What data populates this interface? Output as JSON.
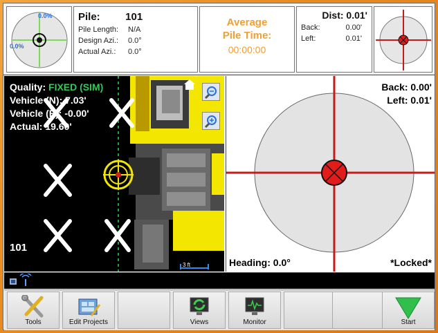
{
  "top": {
    "target_pct_top": "0.0%",
    "target_pct_left": "0.0%",
    "pile_label": "Pile:",
    "pile_number": "101",
    "pile_length_label": "Pile Length:",
    "pile_length_value": "N/A",
    "design_azi_label": "Design Azi.:",
    "design_azi_value": "0.0°",
    "actual_azi_label": "Actual Azi.:",
    "actual_azi_value": "0.0°",
    "avg_title_1": "Average",
    "avg_title_2": "Pile Time:",
    "avg_time": "00:00:00",
    "dist_label": "Dist: 0.01'",
    "back_label": "Back:",
    "back_value": "0.00'",
    "left_label": "Left:",
    "left_value": "0.01'"
  },
  "map": {
    "quality_label": "Quality:",
    "quality_value": "FIXED (SIM)",
    "vehicle_n": "Vehicle (N): 7.03'",
    "vehicle_e": "Vehicle (E): -0.00'",
    "actual": "Actual: 19.60'",
    "pile_id": "101",
    "scale": "3 ft"
  },
  "bullseye": {
    "back": "Back: 0.00'",
    "left": "Left: 0.01'",
    "heading": "Heading: 0.0°",
    "locked": "*Locked*"
  },
  "toolbar": {
    "tools": "Tools",
    "edit_projects": "Edit Projects",
    "views": "Views",
    "monitor": "Monitor",
    "start": "Start"
  },
  "colors": {
    "accent_orange": "#f0a033",
    "fixed_green": "#34c759",
    "crosshair_red": "#c61a1a",
    "machine_yellow": "#f3e600",
    "start_green": "#2fbf4a"
  },
  "icons": [
    "target-icon",
    "crosshair-icon",
    "zoom-out-icon",
    "zoom-in-icon",
    "signal-icon",
    "wrench-screwdriver-icon",
    "projects-icon",
    "views-icon",
    "monitor-icon",
    "start-arrow-icon"
  ]
}
